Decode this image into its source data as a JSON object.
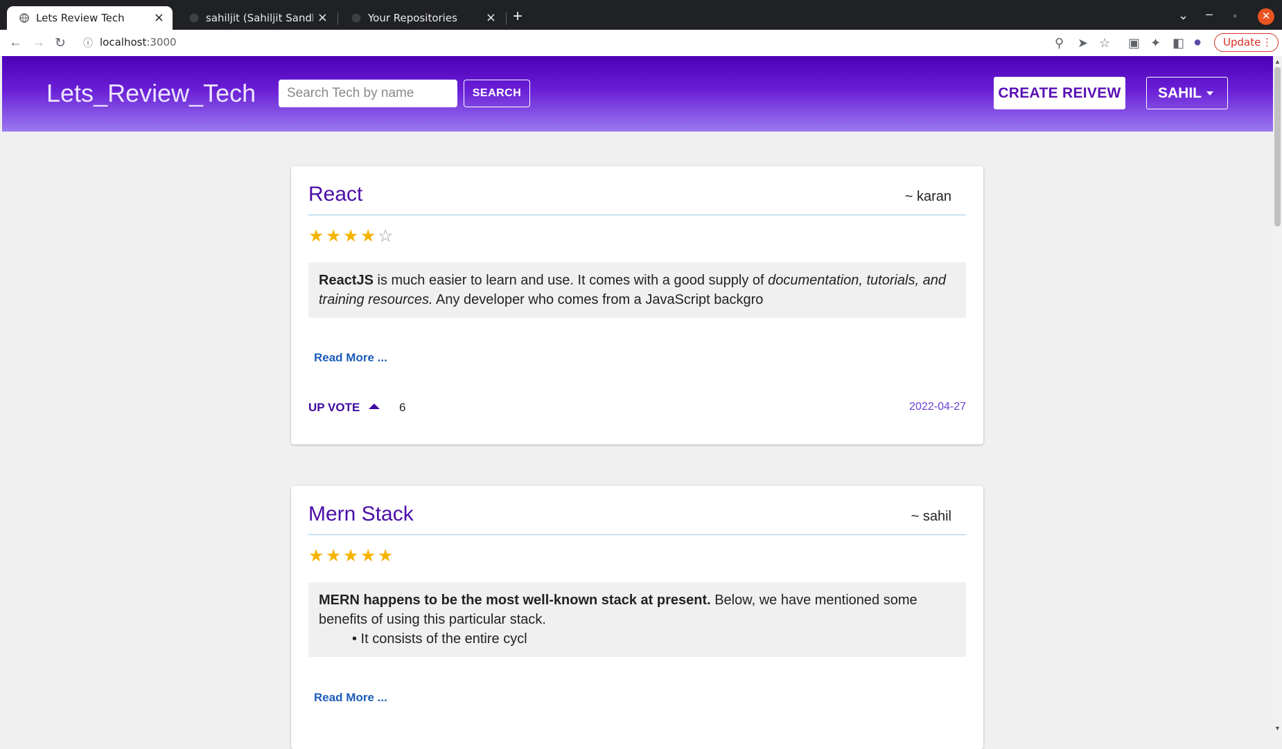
{
  "browser": {
    "tabs": [
      {
        "title": "Lets Review Tech",
        "active": true
      },
      {
        "title": "sahiljit (Sahiljit Sandhu)",
        "active": false
      },
      {
        "title": "Your Repositories",
        "active": false
      }
    ],
    "url_host": "localhost",
    "url_port": ":3000",
    "update_label": "Update",
    "extension_badge": "1"
  },
  "header": {
    "brand": "Lets_Review_Tech",
    "search_placeholder": "Search Tech by name",
    "search_label": "SEARCH",
    "create_label": "CREATE REIVEW",
    "user_label": "SAHIL"
  },
  "colors": {
    "header_top": "#4b00b5",
    "header_bottom": "#9a7af0",
    "title": "#4a0ea8",
    "star": "#f5b400",
    "link": "#1d5cb8"
  },
  "reviews": [
    {
      "title": "React",
      "author": "~ karan",
      "rating": 4,
      "rating_max": 5,
      "body_bold": "ReactJS",
      "body_text_1": " is much easier to learn and use. It comes with a good supply of ",
      "body_italic": "documentation, tutorials, and training resources.",
      "body_text_2": " Any developer who comes from a JavaScript backgro",
      "read_more": "Read More ...",
      "upvote_label": "UP VOTE",
      "votes": "6",
      "date": "2022-04-27"
    },
    {
      "title": "Mern Stack",
      "author": "~ sahil",
      "rating": 5,
      "rating_max": 5,
      "body_bold": "MERN happens to be the most well-known stack at present.",
      "body_text_1": " Below, we have mentioned some benefits of using this particular stack.",
      "body_bullet": "• It consists of the entire cycl",
      "read_more": "Read More ..."
    }
  ]
}
